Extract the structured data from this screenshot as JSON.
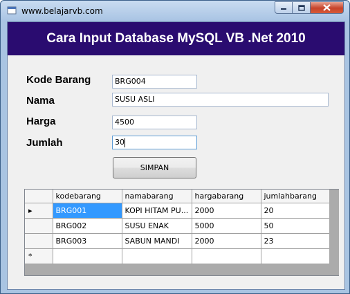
{
  "window": {
    "title": "www.belajarvb.com",
    "controls": {
      "minimize": "minimize-icon",
      "maximize": "maximize-icon",
      "close": "close-icon"
    }
  },
  "banner": {
    "text": "Cara Input Database MySQL VB .Net 2010"
  },
  "form": {
    "kode_label": "Kode Barang",
    "kode_value": "BRG004",
    "nama_label": "Nama",
    "nama_value": "SUSU ASLI",
    "harga_label": "Harga",
    "harga_value": "4500",
    "jumlah_label": "Jumlah",
    "jumlah_value": "30",
    "save_label": "SIMPAN"
  },
  "grid": {
    "columns": [
      "kodebarang",
      "namabarang",
      "hargabarang",
      "jumlahbarang"
    ],
    "rows": [
      [
        "BRG001",
        "KOPI HITAM PU...",
        "2000",
        "20"
      ],
      [
        "BRG002",
        "SUSU ENAK",
        "5000",
        "50"
      ],
      [
        "BRG003",
        "SABUN MANDI",
        "2000",
        "23"
      ]
    ],
    "row_markers": {
      "current": "▸",
      "new": "*"
    }
  },
  "colors": {
    "banner_bg": "#2a0c70",
    "selection": "#3399ff",
    "form_bg": "#f0f0f0",
    "grid_bg": "#ababab"
  }
}
